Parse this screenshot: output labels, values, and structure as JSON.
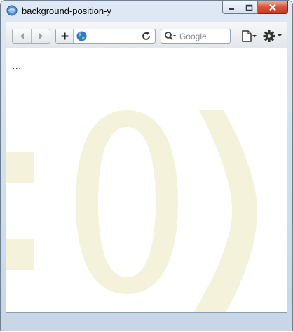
{
  "window": {
    "title": "background-position-y",
    "app_icon": "globe-icon"
  },
  "caption_buttons": {
    "minimize_icon": "minimize-icon",
    "maximize_icon": "maximize-icon",
    "close_icon": "close-icon"
  },
  "toolbar": {
    "back_icon": "back-arrow-icon",
    "forward_icon": "forward-arrow-icon",
    "add_icon": "plus-icon",
    "url_value": "",
    "reload_icon": "reload-icon",
    "search_placeholder": "Google",
    "page_menu_icon": "page-icon",
    "tools_menu_icon": "gear-icon"
  },
  "content": {
    "text": "...",
    "background_text": ":0)",
    "background_color": "#f5f2dc"
  }
}
